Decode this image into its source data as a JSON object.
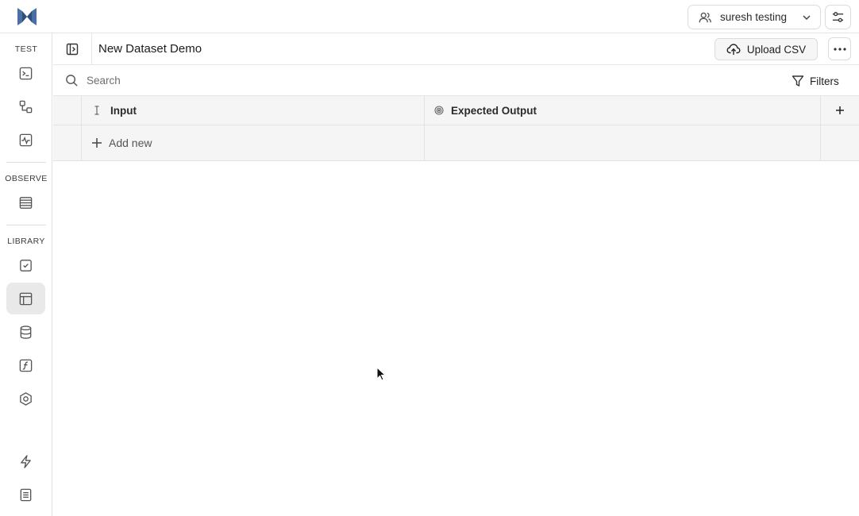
{
  "topbar": {
    "user_name": "suresh testing",
    "icons": [
      "logo-icon",
      "users-icon",
      "chevron-down-icon",
      "sliders-icon"
    ]
  },
  "sidebar": {
    "sections": [
      {
        "label": "TEST",
        "items": [
          "terminal-icon",
          "workflow-icon",
          "activity-icon"
        ]
      },
      {
        "label": "OBSERVE",
        "items": [
          "table-list-icon"
        ]
      },
      {
        "label": "LIBRARY",
        "items": [
          "checkbox-icon",
          "dataset-table-icon",
          "database-icon",
          "function-icon",
          "hexagon-icon"
        ]
      }
    ],
    "bottom_items": [
      "zap-icon",
      "document-icon"
    ],
    "active_item": "dataset-table-icon"
  },
  "header": {
    "title": "New Dataset Demo",
    "upload_label": "Upload CSV"
  },
  "search": {
    "placeholder": "Search",
    "value": "",
    "filters_label": "Filters"
  },
  "table": {
    "columns": [
      {
        "label": "Input",
        "icon": "text-cursor-icon"
      },
      {
        "label": "Expected Output",
        "icon": "target-icon"
      }
    ],
    "add_row_label": "Add new",
    "rows": []
  },
  "colors": {
    "row_bg": "#f5f5f5",
    "active_bg": "#e9e9e9",
    "border": "#e2e2e2",
    "logo": "#4a6fa5"
  }
}
